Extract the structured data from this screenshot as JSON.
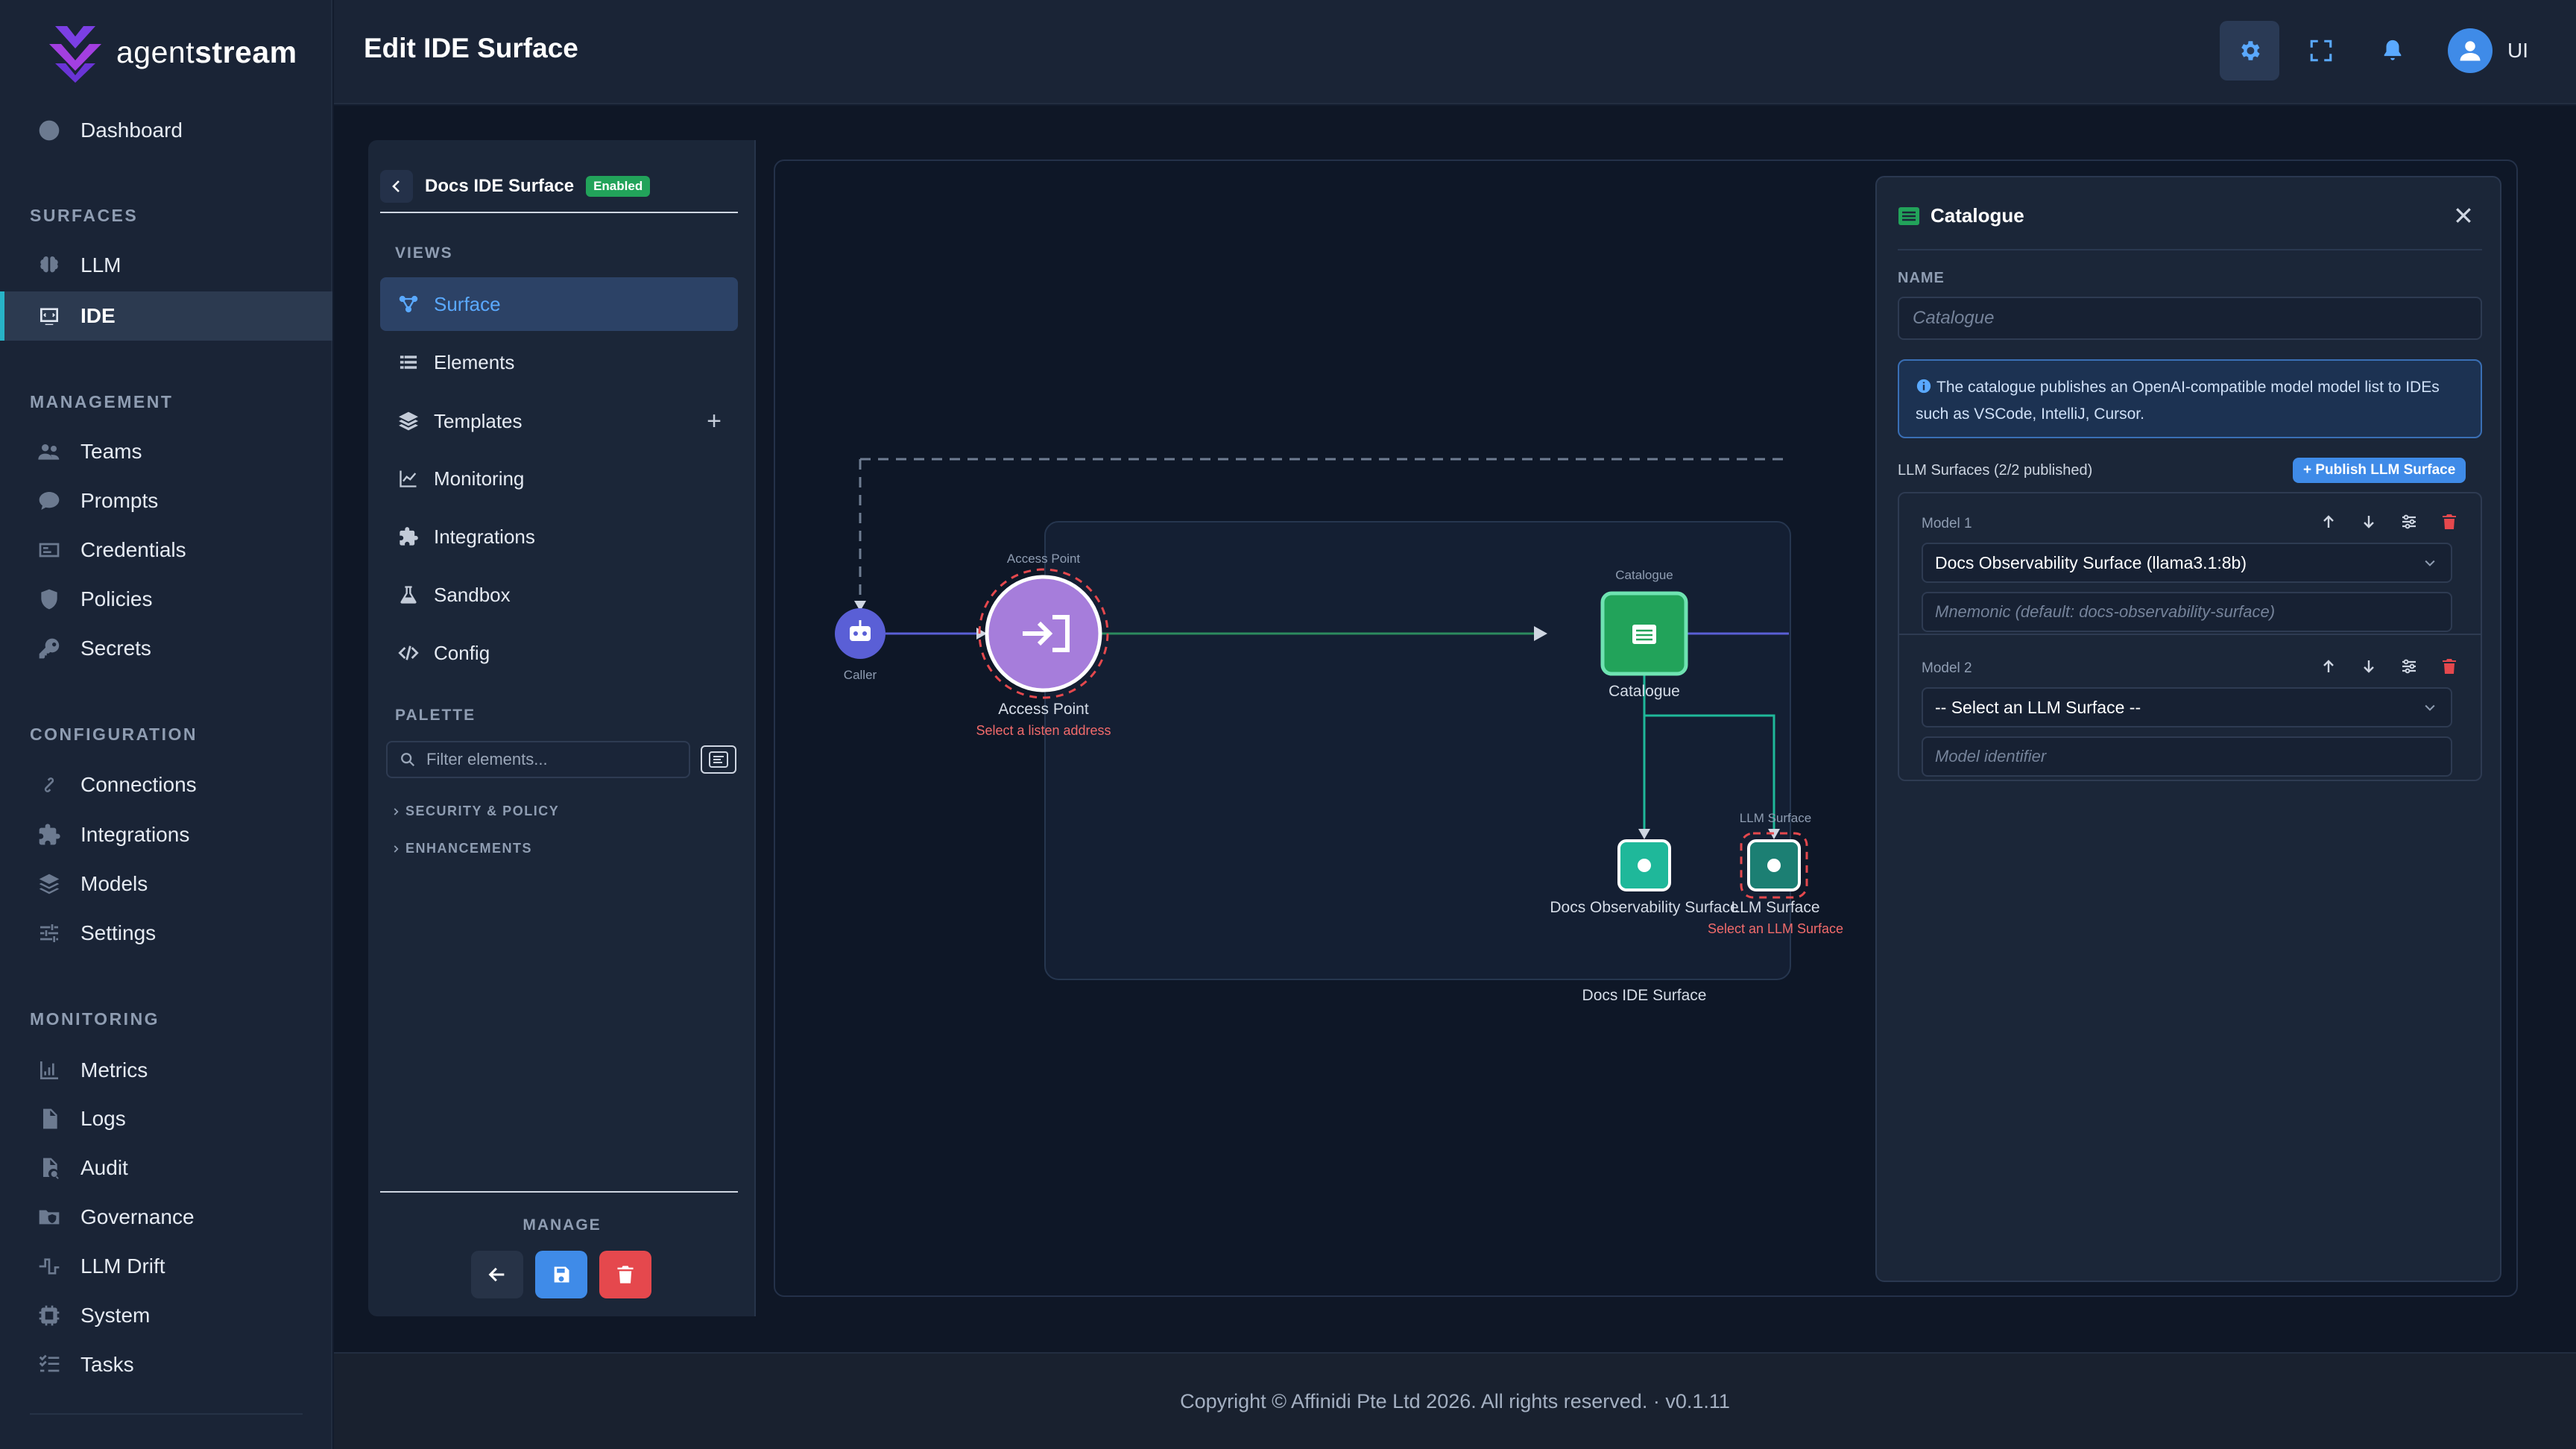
{
  "brand": {
    "name_light": "agent",
    "name_bold": "stream"
  },
  "nav": {
    "dashboard": "Dashboard",
    "surfaces_head": "SURFACES",
    "llm": "LLM",
    "ide": "IDE",
    "management_head": "MANAGEMENT",
    "teams": "Teams",
    "prompts": "Prompts",
    "credentials": "Credentials",
    "policies": "Policies",
    "secrets": "Secrets",
    "configuration_head": "CONFIGURATION",
    "connections": "Connections",
    "integrations": "Integrations",
    "models": "Models",
    "settings": "Settings",
    "monitoring_head": "MONITORING",
    "metrics": "Metrics",
    "logs": "Logs",
    "audit": "Audit",
    "governance": "Governance",
    "llm_drift": "LLM Drift",
    "system": "System",
    "tasks": "Tasks"
  },
  "header": {
    "title": "Edit IDE Surface",
    "user": "UI"
  },
  "editor": {
    "surface_name": "Docs IDE Surface",
    "badge": "Enabled",
    "views_head": "VIEWS",
    "views": [
      "Surface",
      "Elements",
      "Templates",
      "Monitoring",
      "Integrations",
      "Sandbox",
      "Config"
    ],
    "palette_head": "PALETTE",
    "palette_placeholder": "Filter elements...",
    "groups": [
      "SECURITY & POLICY",
      "ENHANCEMENTS"
    ],
    "manage_head": "MANAGE"
  },
  "canvas": {
    "caller": "Caller",
    "access_point_top": "Access Point",
    "access_point": "Access Point",
    "access_point_warn": "Select a listen address",
    "catalogue_top": "Catalogue",
    "catalogue": "Catalogue",
    "docs_obs": "Docs Observability Surface",
    "llm_top": "LLM Surface",
    "llm": "LLM Surface",
    "llm_warn": "Select an LLM Surface",
    "group": "Docs IDE Surface"
  },
  "panel": {
    "title": "Catalogue",
    "name_label": "NAME",
    "name_placeholder": "Catalogue",
    "info": "The catalogue publishes an OpenAI-compatible model model list to IDEs such as VSCode, IntelliJ, Cursor.",
    "list_head": "LLM Surfaces (2/2 published)",
    "publish": "+ Publish LLM Surface",
    "models": [
      {
        "head": "Model 1",
        "select": "Docs Observability Surface (llama3.1:8b)",
        "placeholder": "Mnemonic (default: docs-observability-surface)"
      },
      {
        "head": "Model 2",
        "select": "-- Select an LLM Surface --",
        "placeholder": "Model identifier"
      }
    ]
  },
  "footer": {
    "text": "Copyright © Affinidi Pte Ltd 2026. All rights reserved. · v0.1.11"
  },
  "colors": {
    "accent": "#3f8be8",
    "active_bar": "#27b3c7",
    "success": "#22a35a",
    "danger": "#e5484d",
    "access_point": "#a67ddb",
    "catalogue_node": "#22a35a",
    "llm_node": "#1fb89a"
  }
}
